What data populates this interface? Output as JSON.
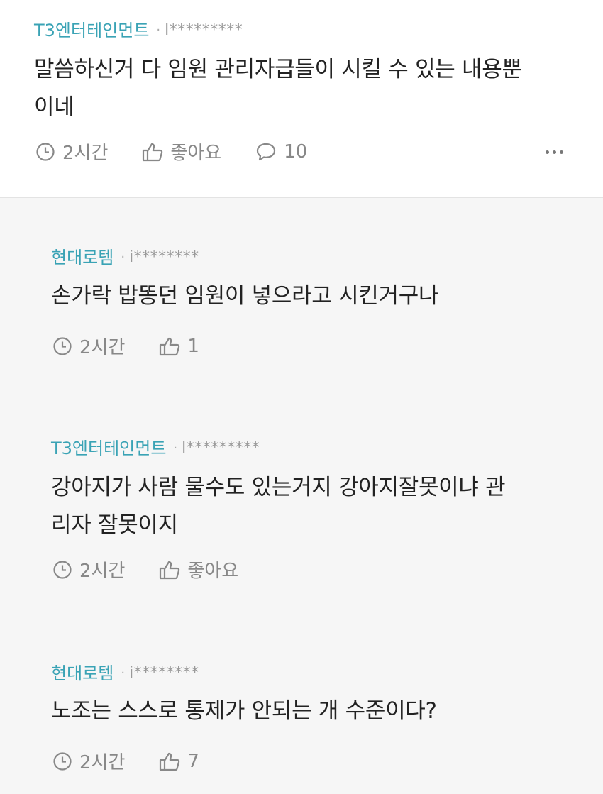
{
  "comments": [
    {
      "company": "T3엔터테인먼트",
      "author": "l*********",
      "body_lines": [
        "말씀하신거 다 임원 관리자급들이 시킬 수 있는 내용뿐",
        "이네"
      ],
      "time": "2시간",
      "like_label": "좋아요",
      "reply_count": "10"
    },
    {
      "company": "현대로템",
      "author": "i********",
      "body_lines": [
        "손가락 밥똥던 임원이 넣으라고 시킨거구나"
      ],
      "time": "2시간",
      "like_label": "1"
    },
    {
      "company": "T3엔터테인먼트",
      "author": "l*********",
      "body_lines": [
        "강아지가 사람 물수도 있는거지 강아지잘못이냐 관",
        "리자 잘못이지"
      ],
      "time": "2시간",
      "like_label": "좋아요"
    },
    {
      "company": "현대로템",
      "author": "i********",
      "body_lines": [
        "노조는 스스로 통제가 안되는 개 수준이다?"
      ],
      "time": "2시간",
      "like_label": "7"
    }
  ],
  "icons": {
    "clock": "clock-icon",
    "thumb": "thumbs-up-icon",
    "reply": "speech-bubble-icon",
    "more": "more-options-icon"
  },
  "colors": {
    "company": "#3aa3b5",
    "muted": "#888888",
    "text": "#222222",
    "top_bg": "#ffffff",
    "reply_bg": "#f6f6f6"
  }
}
